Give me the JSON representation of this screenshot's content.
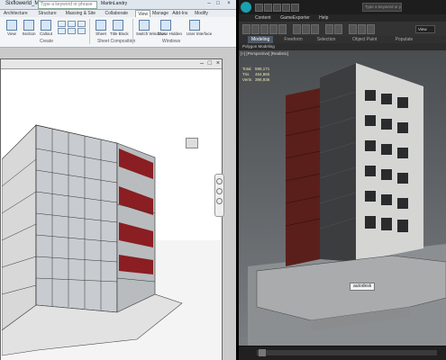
{
  "left_app": {
    "title": "Sixflowerld_Mi...",
    "search_placeholder": "Type a keyword or phrase",
    "user": "MartinLandry",
    "tabs": [
      "Architecture",
      "Structure",
      "Massing & Site",
      "Collaborate",
      "View",
      "Manage",
      "Add-Ins",
      "Modify"
    ],
    "active_tab": "View",
    "ribbon": {
      "create": {
        "label": "Create",
        "buttons": [
          "View",
          "Section",
          "Callout"
        ]
      },
      "sheet": {
        "label": "Sheet Composition",
        "buttons": [
          "Sheet",
          "Title Block",
          "Matchline"
        ]
      },
      "windows": {
        "label": "Windows",
        "buttons": [
          "Switch Windows",
          "Close Hidden",
          "User Interface"
        ]
      }
    }
  },
  "right_app": {
    "search_placeholder": "Type a keyword or phrase",
    "menu": [
      "Content",
      "GameExporter",
      "Help"
    ],
    "tabs": [
      "Modeling",
      "Freeform",
      "Selection",
      "Object Paint",
      "Populate"
    ],
    "active_tab": "Modeling",
    "sub_label": "Polygon Modeling",
    "viewport_label": "[+] [Perspective] [Realistic]",
    "dropdown": "View",
    "stats": [
      {
        "name": "Total",
        "value": "596,171"
      },
      {
        "name": "Tris",
        "value": "464,865"
      },
      {
        "name": "Verts",
        "value": "396,936"
      }
    ],
    "tooltip": "autodesk"
  }
}
